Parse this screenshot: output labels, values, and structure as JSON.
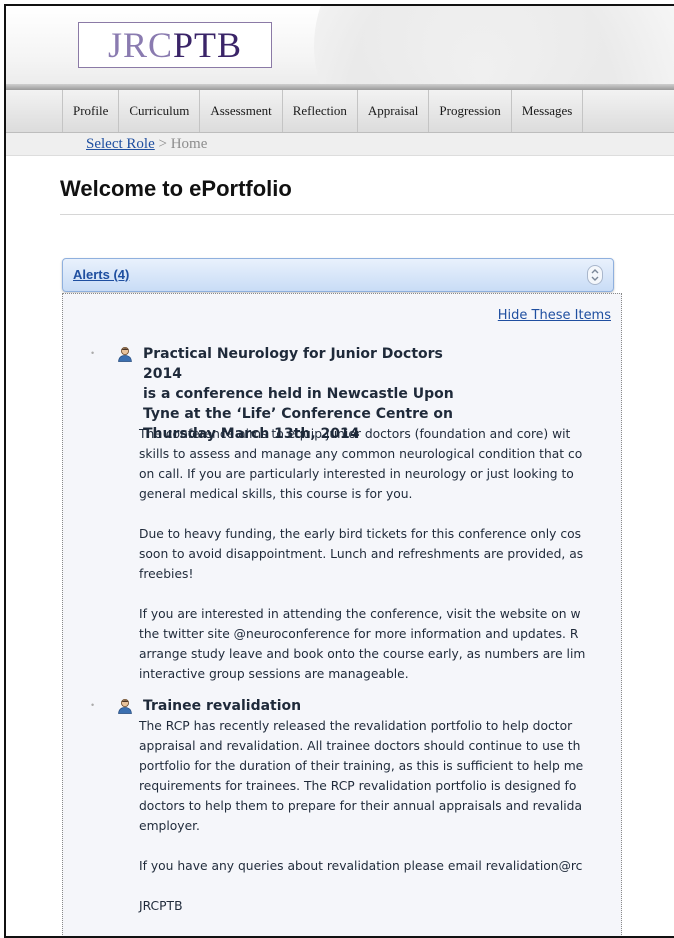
{
  "brand": {
    "logo_part1": "JRC",
    "logo_part2": "PTB"
  },
  "nav": {
    "items": [
      "Profile",
      "Curriculum",
      "Assessment",
      "Reflection",
      "Appraisal",
      "Progression",
      "Messages"
    ]
  },
  "breadcrumb": {
    "link_label": "Select Role",
    "separator": " > ",
    "current": "Home"
  },
  "page": {
    "title": "Welcome to ePortfolio"
  },
  "alerts": {
    "header_label": "Alerts (4)",
    "hide_label": "Hide These Items",
    "items": [
      {
        "title_lines": [
          "Practical Neurology for Junior Doctors 2014",
          "is a conference held in Newcastle Upon",
          "Tyne at the ‘Life’ Conference Centre on",
          "Thursday March 13th, 2014"
        ],
        "paragraphs": [
          [
            "The conference aims to equip junior doctors (foundation and core) wit",
            "skills to assess and manage any common neurological condition that co",
            "on call. If you are particularly interested in neurology or just looking to",
            "general medical skills, this course is for you."
          ],
          [
            "Due to heavy funding, the early bird tickets for this conference only cos",
            "soon to avoid disappointment. Lunch and refreshments are provided, as",
            "freebies!"
          ],
          [
            "If you are interested in attending the conference, visit the website on w",
            "the twitter site @neuroconference for more information and updates. R",
            "arrange study leave and book onto the course early, as numbers are lim",
            "interactive group sessions are manageable."
          ]
        ]
      },
      {
        "title_lines": [
          "Trainee revalidation"
        ],
        "paragraphs": [
          [
            "The RCP has recently released the revalidation portfolio to help doctor",
            "appraisal and revalidation. All trainee doctors should continue to use th",
            "portfolio for the duration of their training, as this is sufficient to help me",
            "requirements for trainees. The RCP revalidation portfolio is designed fo",
            "doctors to help them to prepare for their annual appraisals and revalida",
            "employer."
          ],
          [
            "If you have any queries about revalidation please email revalidation@rc"
          ],
          [
            "JRCPTB"
          ]
        ]
      }
    ]
  }
}
